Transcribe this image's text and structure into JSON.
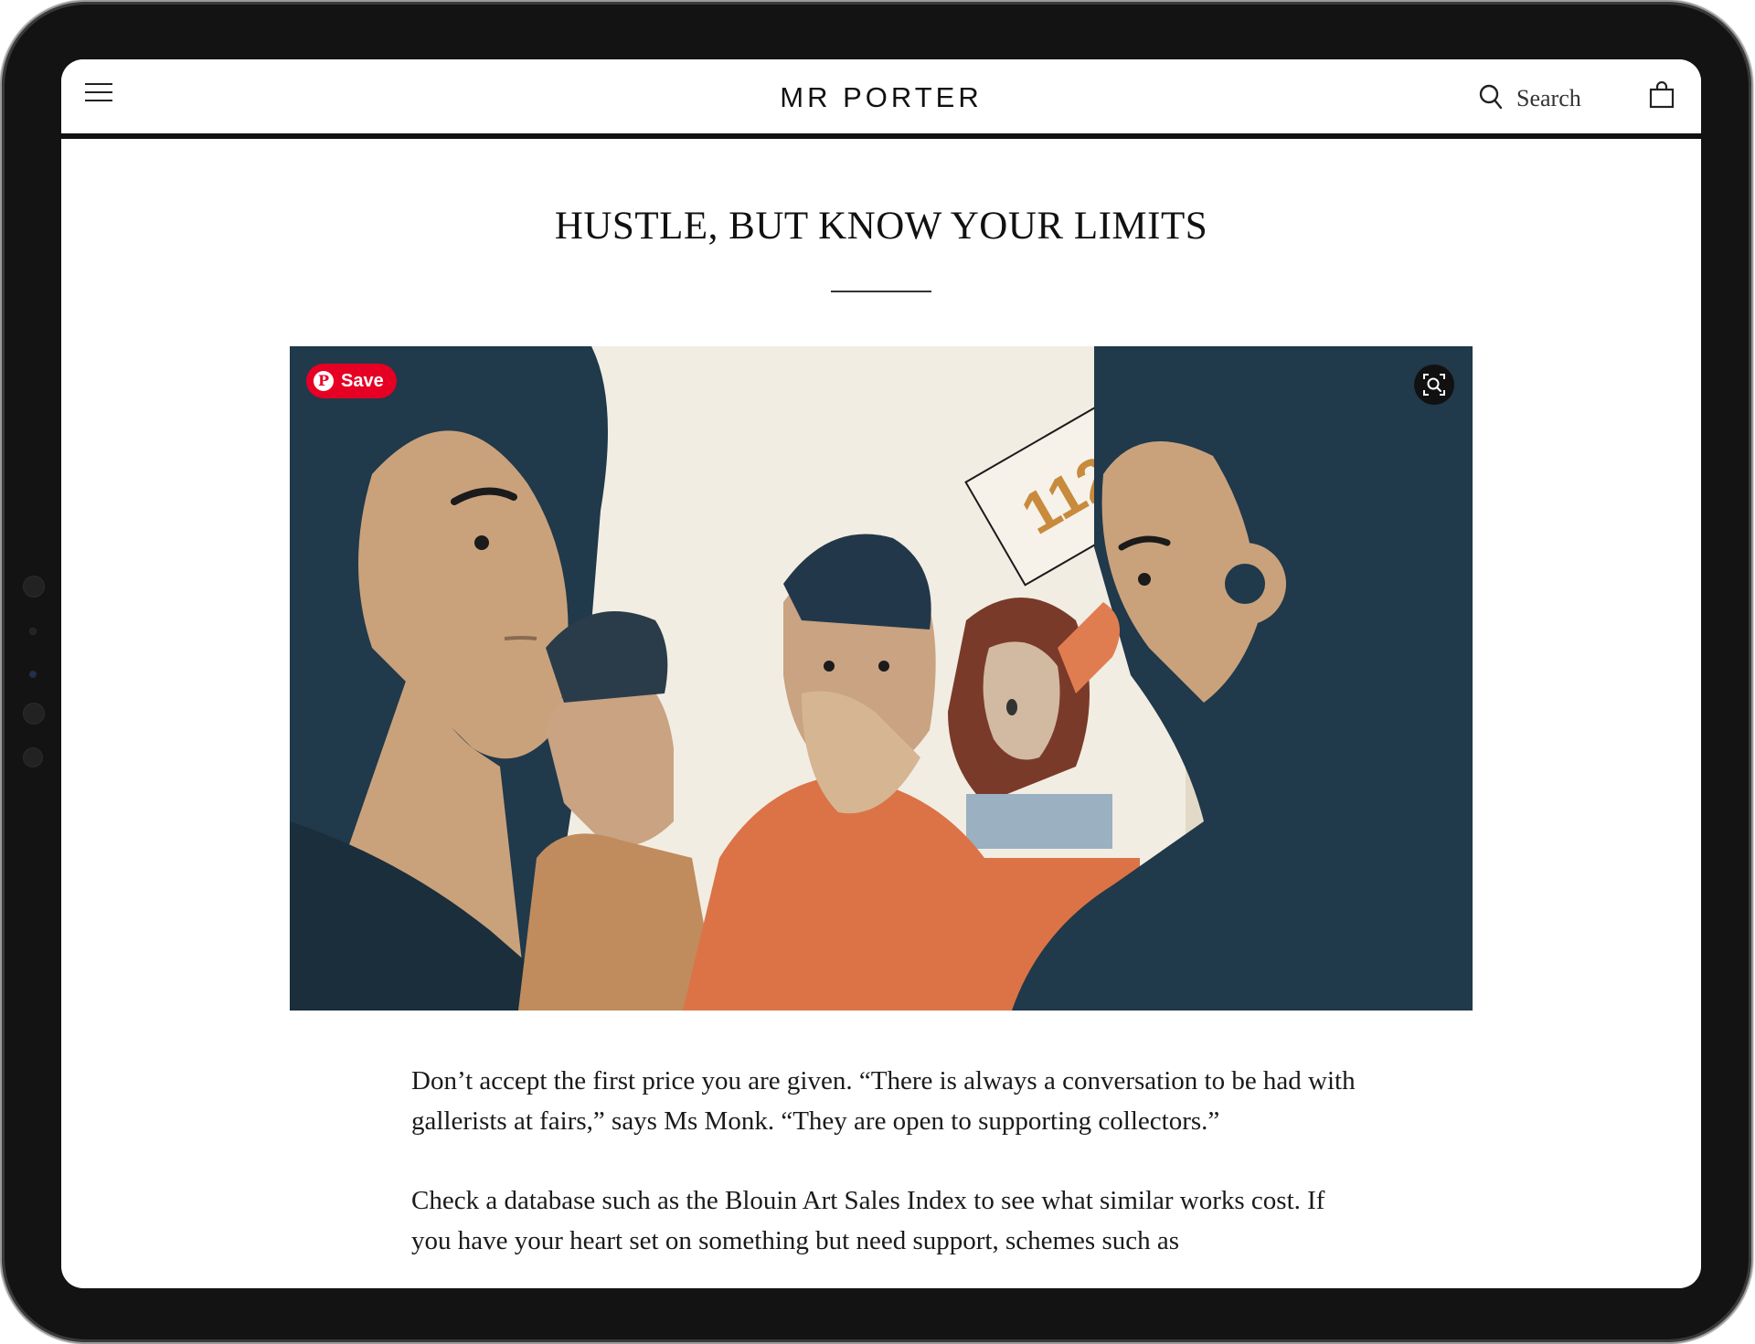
{
  "header": {
    "logo": "MR PORTER",
    "search_label": "Search",
    "icons": {
      "menu": "hamburger-menu-icon",
      "search": "search-icon",
      "bag": "shopping-bag-icon"
    }
  },
  "article": {
    "title": "HUSTLE, BUT KNOW YOUR LIMITS",
    "hero_image": {
      "description_icon": "auction-illustration",
      "paddle_number": "112",
      "save_button_label": "Save",
      "zoom_icon": "zoom-in-icon",
      "pinterest_color": "#e60023"
    },
    "paragraphs": [
      "Don’t accept the first price you are given. “There is always a conversation to be had with gallerists at fairs,” says Ms Monk. “They are open to supporting collectors.”",
      "Check a database such as the Blouin Art Sales Index to see what similar works cost. If you have your heart set on something but need support, schemes such as"
    ]
  }
}
